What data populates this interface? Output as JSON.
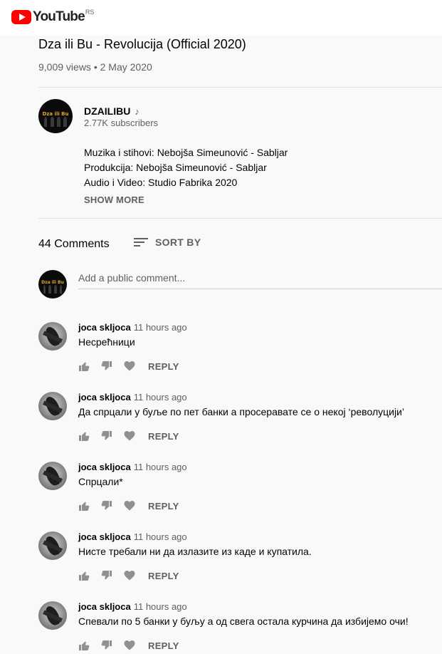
{
  "brand": {
    "wordmark": "YouTube",
    "region": "RS"
  },
  "video": {
    "title": "Dza ili Bu - Revolucija (Official 2020)",
    "meta": "9,009 views • 2 May 2020"
  },
  "channel": {
    "avatar_text": "Dza ili Bu",
    "name": "DZAILIBU",
    "icon": "music-note-icon",
    "subscribers": "2.77K subscribers",
    "description": [
      "Muzika i stihovi: Nebojša Simeunović - Sabljar",
      "Produkcija: Nebojša Simeunović - Sabljar",
      "Audio i Video: Studio Fabrika 2020"
    ],
    "show_more": "SHOW MORE"
  },
  "comments": {
    "count_label": "44 Comments",
    "sort_label": "SORT BY",
    "add_placeholder": "Add a public comment...",
    "reply_label": "REPLY",
    "items": [
      {
        "author": "joca skljoca",
        "time": "11 hours ago",
        "text": "Несрећници"
      },
      {
        "author": "joca skljoca",
        "time": "11 hours ago",
        "text": "Да спрцали у буље по пет банки а просеравате се о некој ‘револуцији’"
      },
      {
        "author": "joca skljoca",
        "time": "11 hours ago",
        "text": "Спрцали*"
      },
      {
        "author": "joca skljoca",
        "time": "11 hours ago",
        "text": "Нисте требали ни да излазите из каде и купатила."
      },
      {
        "author": "joca skljoca",
        "time": "11 hours ago",
        "text": "Спевали по 5 банки у буљу а од свега остала курчина да избијемо очи!"
      }
    ]
  },
  "colors": {
    "brand_red": "#ff0000",
    "background": "#f9f9f9",
    "secondary_text": "#606060",
    "band_logo": "#e0a62a"
  }
}
